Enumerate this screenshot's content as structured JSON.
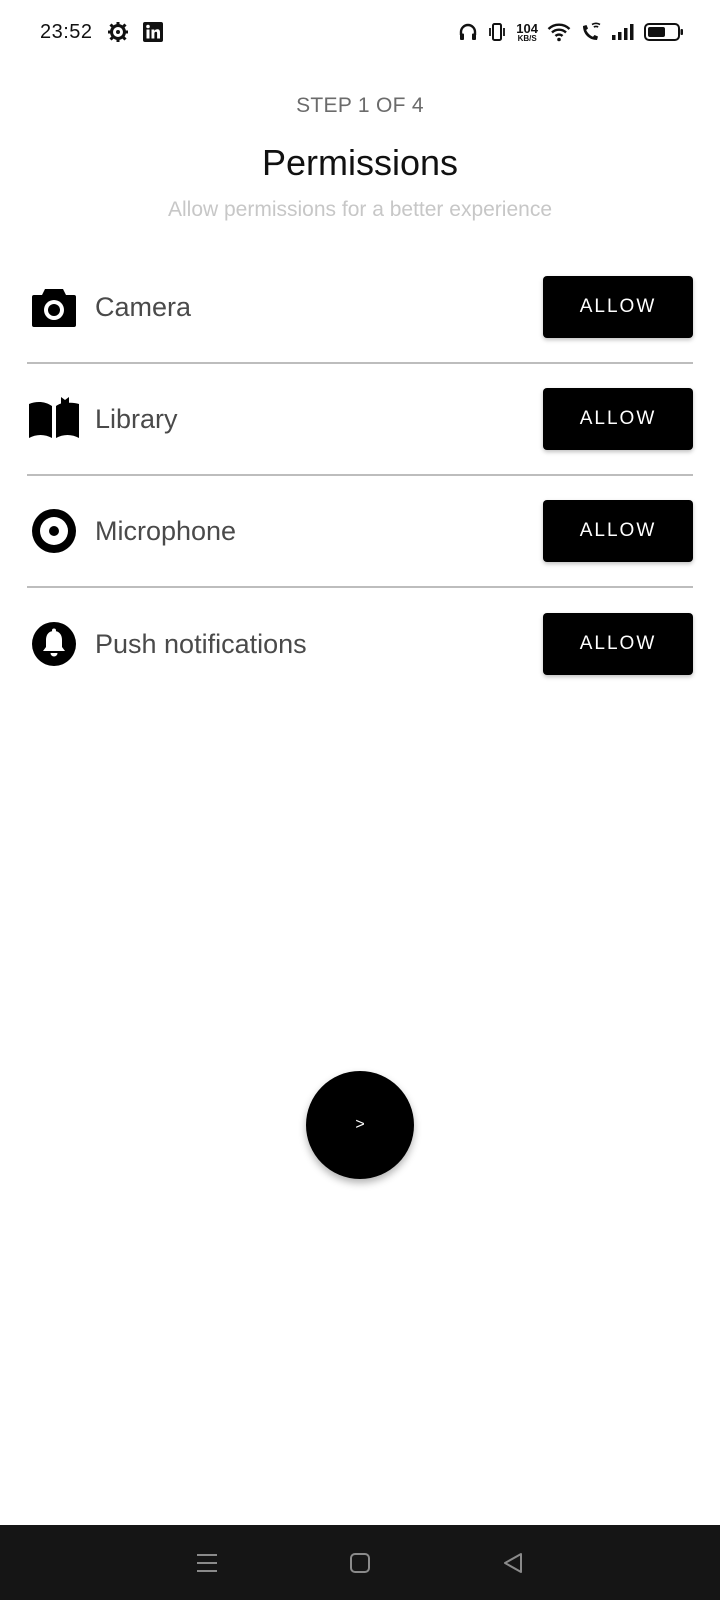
{
  "status_bar": {
    "time": "23:52",
    "net_speed_value": "104",
    "net_speed_unit": "KB/S",
    "left_icons": [
      "settings-gear-icon",
      "linkedin-icon"
    ],
    "right_icons": [
      "headphones-icon",
      "vibrate-icon",
      "wifi-icon",
      "wifi-calling-icon",
      "signal-icon",
      "battery-icon"
    ]
  },
  "header": {
    "step": "STEP 1 OF 4",
    "title": "Permissions",
    "subtitle": "Allow permissions for a better experience"
  },
  "permissions": [
    {
      "label": "Camera",
      "icon": "camera-icon",
      "button": "ALLOW"
    },
    {
      "label": "Library",
      "icon": "book-icon",
      "button": "ALLOW"
    },
    {
      "label": "Microphone",
      "icon": "record-icon",
      "button": "ALLOW"
    },
    {
      "label": "Push notifications",
      "icon": "bell-icon",
      "button": "ALLOW"
    }
  ],
  "fab": {
    "label": ">"
  },
  "nav_bar": {
    "icons": [
      "menu-icon",
      "home-icon",
      "back-icon"
    ]
  },
  "colors": {
    "background": "#ffffff",
    "button_bg": "#000000",
    "button_text": "#ffffff",
    "divider": "#bdbdbd",
    "subtitle": "#c7c7c7",
    "nav_bg": "#151515"
  }
}
